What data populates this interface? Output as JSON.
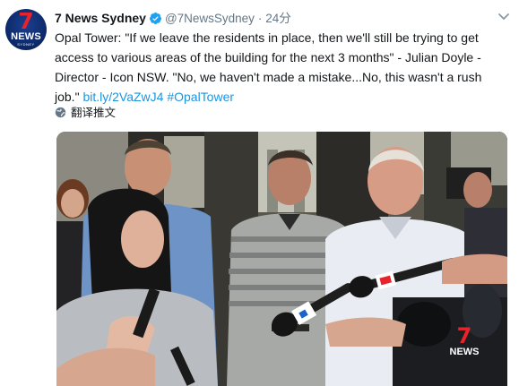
{
  "tweet": {
    "display_name": "7 News Sydney",
    "handle": "@7NewsSydney",
    "separator": "·",
    "time": "24分",
    "text_lines": [
      "Opal Tower: \"If we leave the residents in place, then we'll still be trying to get",
      "access to various areas of the building for the next 3 months\" - Julian Doyle -",
      "Director - Icon NSW. \"No, we haven't made a mistake...No, this wasn't a rush"
    ],
    "text_last": "job.\"",
    "link": "bit.ly/2VaZwJ4",
    "hashtag": "#OpalTower",
    "translate_label": "翻译推文"
  },
  "avatar": {
    "logo_number": "7",
    "logo_text": "NEWS",
    "logo_sub": "SYDNEY"
  },
  "video": {
    "watermark_number": "7",
    "watermark_text": "NEWS"
  },
  "colors": {
    "link": "#1b95e0",
    "verified": "#1da1f2",
    "secondary_text": "#657786",
    "brand_red": "#e8232b"
  }
}
